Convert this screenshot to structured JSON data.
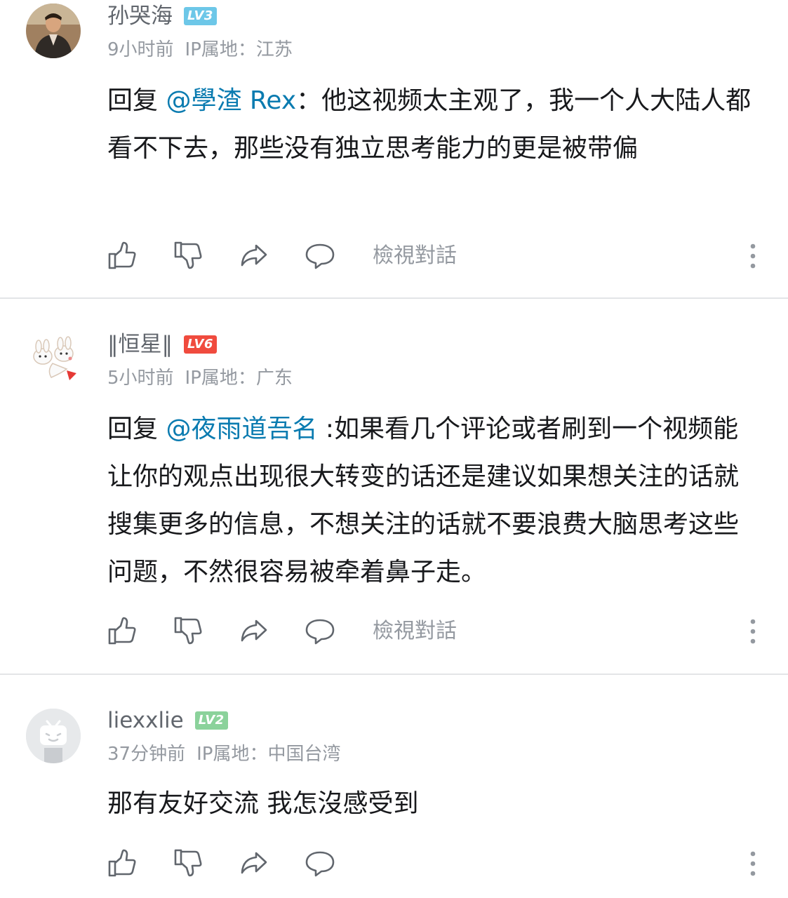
{
  "comments": [
    {
      "username": "孙哭海",
      "level": "LV3",
      "level_color": "#6dc7e8",
      "time": "9小时前",
      "ip_location": "IP属地：江苏",
      "reply_prefix": "回复",
      "mention": "@學渣 Rex",
      "separator": "：",
      "text": "他这视频太主观了，我一个人大陆人都看不下去，那些没有独立思考能力的更是被带偏",
      "view_dialog": "檢視對話"
    },
    {
      "username": "‖恒星‖",
      "level": "LV6",
      "level_color": "#f04b3e",
      "time": "5小时前",
      "ip_location": "IP属地：广东",
      "reply_prefix": "回复",
      "mention": "@夜雨道吾名",
      "separator": " :",
      "text": "如果看几个评论或者刷到一个视频能让你的观点出现很大转变的话还是建议如果想关注的话就搜集更多的信息，不想关注的话就不要浪费大脑思考这些问题，不然很容易被牵着鼻子走。",
      "view_dialog": "檢視對話"
    },
    {
      "username": "liexxlie",
      "level": "LV2",
      "level_color": "#8bd29b",
      "time": "37分钟前",
      "ip_location": "IP属地：中国台湾",
      "text": "那有友好交流 我怎沒感受到"
    }
  ],
  "icons": {
    "like": "thumbs-up-icon",
    "dislike": "thumbs-down-icon",
    "share": "share-icon",
    "reply": "comment-bubble-icon",
    "more": "more-vertical-icon"
  },
  "colors": {
    "mention": "#0a7bb0",
    "meta": "#9499a0",
    "username": "#61666d",
    "text": "#18191c"
  }
}
